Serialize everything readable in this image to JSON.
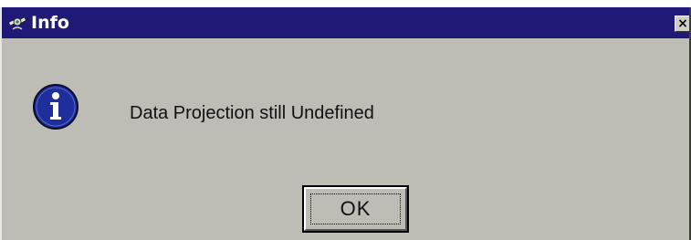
{
  "window": {
    "title": "Info",
    "title_icon": "satellite-icon",
    "close_label": "×"
  },
  "dialog": {
    "icon": "info-icon",
    "message": "Data Projection still Undefined",
    "ok_label": "OK"
  },
  "colors": {
    "titlebar": "#1f1a78",
    "dialog_background": "#bdbdb5",
    "info_icon_fill": "#1e2f9c"
  }
}
